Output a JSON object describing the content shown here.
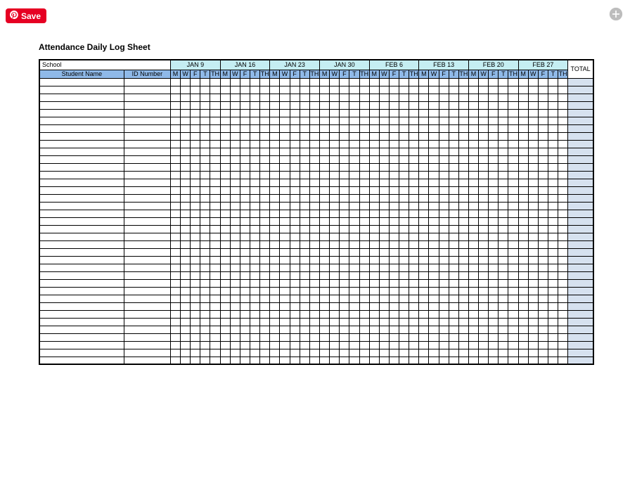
{
  "save_button": {
    "label": "Save"
  },
  "sheet": {
    "title": "Attendance Daily Log Sheet",
    "school_label": "School",
    "student_name_header": "Student Name",
    "id_header": "ID Number",
    "total_header": "TOTAL",
    "weeks": [
      "JAN 9",
      "JAN 16",
      "JAN 23",
      "JAN 30",
      "FEB 6",
      "FEB 13",
      "FEB 20",
      "FEB 27"
    ],
    "days": [
      "M",
      "W",
      "F",
      "T",
      "TH"
    ],
    "row_count": 37
  }
}
